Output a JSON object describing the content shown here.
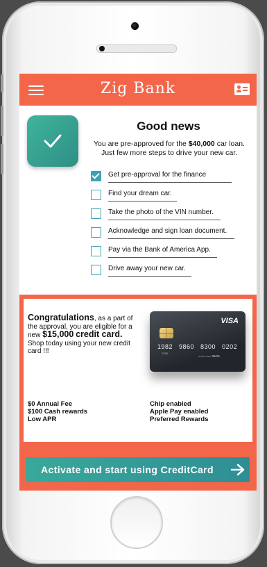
{
  "app": {
    "title": "Zig Bank"
  },
  "icons": {
    "menu": "menu-icon",
    "contact": "contact-card-icon",
    "check": "check-icon",
    "arrow": "arrow-right-icon"
  },
  "colors": {
    "brand": "#f4664a",
    "accent": "#3aa89b",
    "checkbox": "#3aa3b3"
  },
  "status": {
    "heading": "Good news",
    "line1_prefix": "You are pre-approved for the ",
    "amount": "$40,000",
    "line1_suffix": " car loan.",
    "line2": "Just few more steps to drive your new car."
  },
  "steps": [
    {
      "label": "Get pre-approval for the finance",
      "checked": true
    },
    {
      "label": "Find your dream car.",
      "checked": false
    },
    {
      "label": "Take the photo of the VIN number.",
      "checked": false
    },
    {
      "label": "Acknowledge and sign loan document.",
      "checked": false
    },
    {
      "label": "Pay via the Bank of America App.",
      "checked": false
    },
    {
      "label": "Drive away your new car.",
      "checked": false
    }
  ],
  "offer": {
    "congrats_title": "Congratulations",
    "congrats_text1": ", as a part of the approval, you are eligible for a new ",
    "amount": "$15,000",
    "card_label": "credit card.",
    "congrats_text2": " Shop today using your new credit card !!!",
    "features_left": [
      "$0 Annual Fee",
      "$100 Cash rewards",
      "Low APR"
    ],
    "features_right": [
      "Chip enabled",
      "Apple Pay enabled",
      "Preferred Rewards"
    ]
  },
  "card": {
    "brand": "VISA",
    "number": "1982 9860 8300 0202",
    "sub_number": "7283",
    "exp_label": "GOOD THRU",
    "exp": "06/16"
  },
  "cta": {
    "label": "Activate and start using CreditCard"
  }
}
